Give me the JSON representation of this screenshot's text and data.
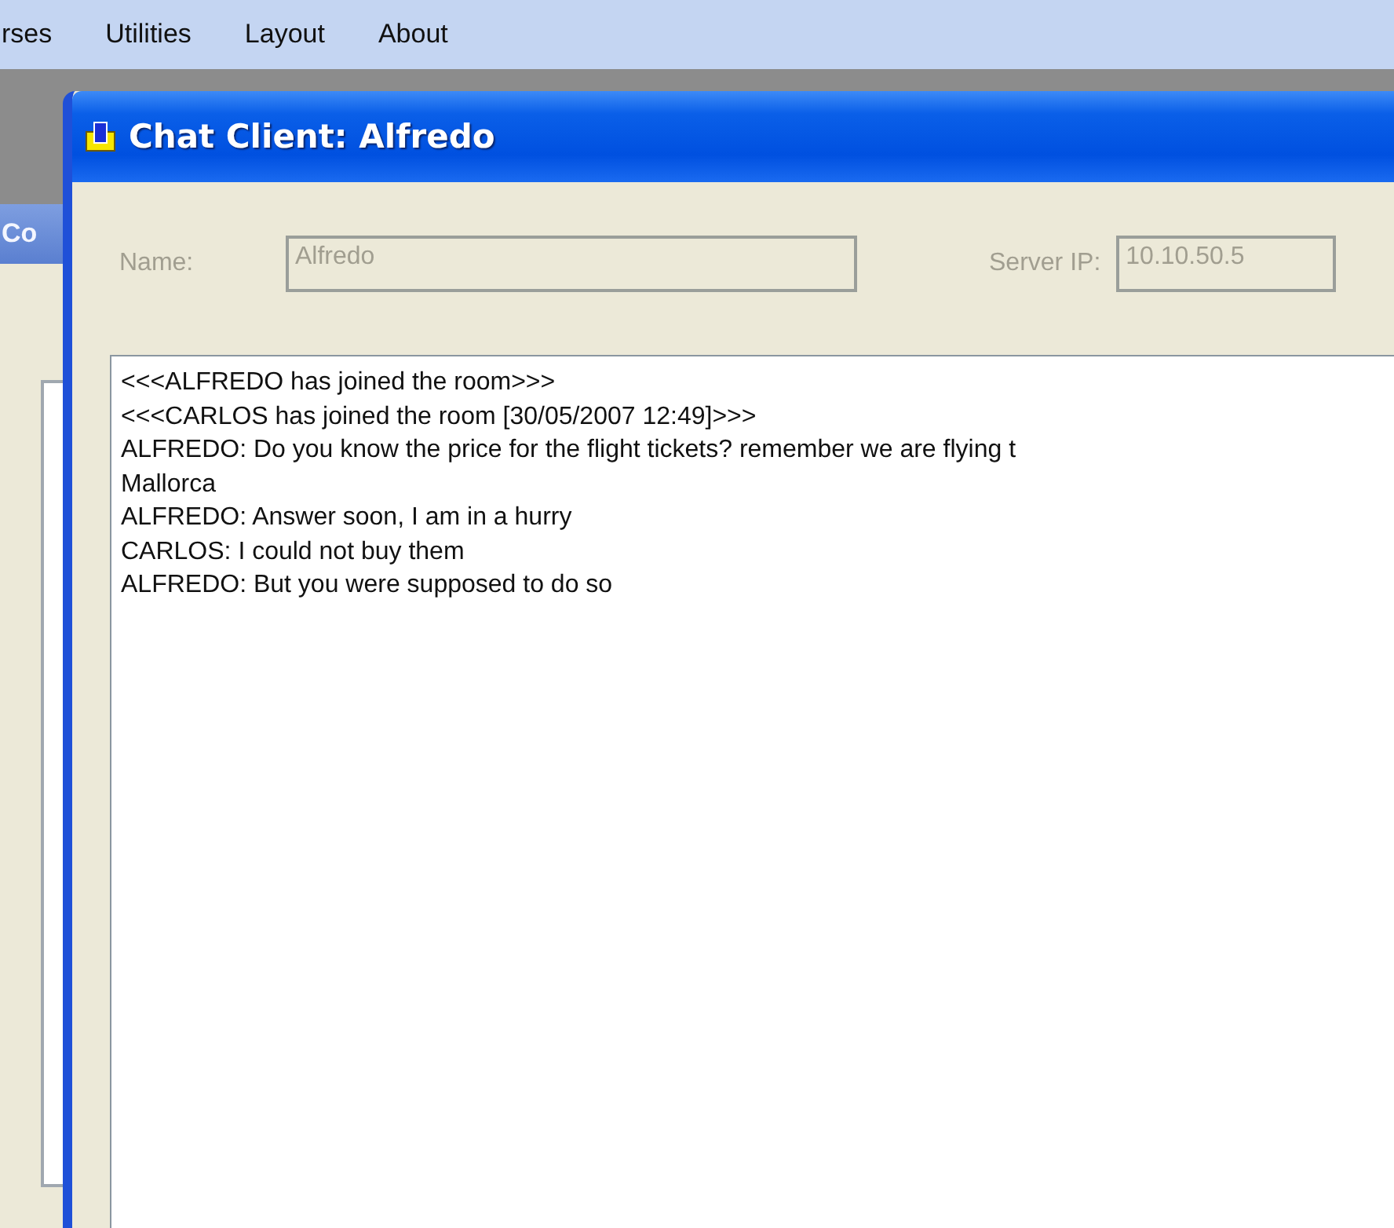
{
  "menu_bar": {
    "items": [
      "rses",
      "Utilities",
      "Layout",
      "About"
    ]
  },
  "background_window": {
    "title": "Co"
  },
  "window": {
    "title": "Chat Client: Alfredo"
  },
  "name_field": {
    "label": "Name:",
    "value": "Alfredo",
    "disabled": true
  },
  "server_field": {
    "label": "Server IP:",
    "value": "10.10.50.5",
    "disabled": true
  },
  "chat_log": {
    "lines": [
      "<<<ALFREDO has joined the room>>>",
      "<<<CARLOS has joined the room [30/05/2007 12:49]>>>",
      "ALFREDO: Do you know the price for the flight tickets? remember we are flying t",
      "Mallorca",
      "ALFREDO: Answer soon, I am in a hurry",
      "CARLOS: I could not buy them",
      "ALFREDO: But you were supposed to do so"
    ]
  }
}
